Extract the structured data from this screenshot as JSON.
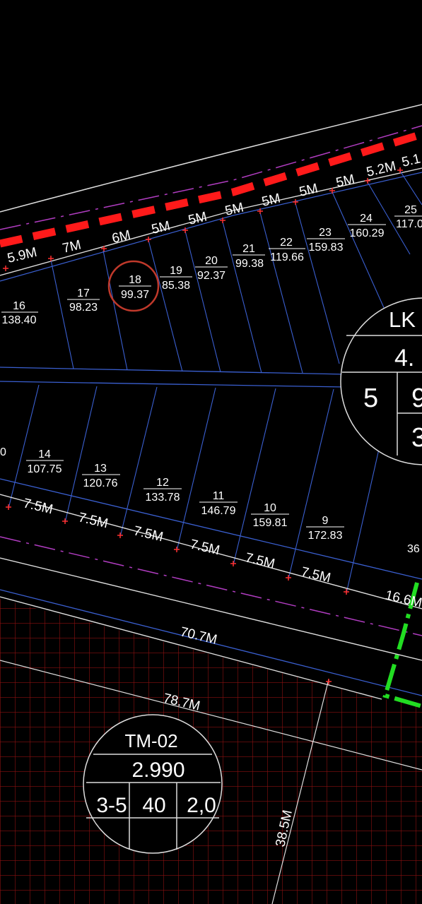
{
  "colors": {
    "background": "#000000",
    "lot_line": "#3a5fd0",
    "boundary_red": "#ff1a1a",
    "grid_red": "#8a1010",
    "highlight_green": "#22dd22",
    "centerline_magenta": "#b03cc0",
    "circle_mark": "#c0392b",
    "text": "#ffffff"
  },
  "top_row": {
    "frontage_dims": [
      "5.9M",
      "7M",
      "6M",
      "5M",
      "5M",
      "5M",
      "5M",
      "5M",
      "5M",
      "5.2M",
      "5.1"
    ],
    "lots": [
      {
        "no": "16",
        "area": "138.40"
      },
      {
        "no": "17",
        "area": "98.23"
      },
      {
        "no": "18",
        "area": "99.37"
      },
      {
        "no": "19",
        "area": "85.38"
      },
      {
        "no": "20",
        "area": "92.37"
      },
      {
        "no": "21",
        "area": "99.38"
      },
      {
        "no": "22",
        "area": "119.66"
      },
      {
        "no": "23",
        "area": "159.83"
      },
      {
        "no": "24",
        "area": "160.29"
      },
      {
        "no": "25",
        "area": "117.0"
      }
    ]
  },
  "bottom_row": {
    "partial_label": "0",
    "lots": [
      {
        "no": "14",
        "area": "107.75"
      },
      {
        "no": "13",
        "area": "120.76"
      },
      {
        "no": "12",
        "area": "133.78"
      },
      {
        "no": "11",
        "area": "146.79"
      },
      {
        "no": "10",
        "area": "159.81"
      },
      {
        "no": "9",
        "area": "172.83"
      }
    ],
    "frontage_dims": [
      "7.5M",
      "7.5M",
      "7.5M",
      "7.5M",
      "7.5M",
      "7.5M"
    ],
    "edge_label": "36",
    "side_dim": "16.6M"
  },
  "road_dims": {
    "road_70": "70.7M",
    "road_78": "78.7M",
    "road_38": "38.5M"
  },
  "block_lk": {
    "name": "LK",
    "area": "4.",
    "floors": "5",
    "density": "9",
    "far": "3"
  },
  "block_tm": {
    "name": "TM-02",
    "area": "2.990",
    "floors": "3-5",
    "density": "40",
    "far": "2,0"
  }
}
